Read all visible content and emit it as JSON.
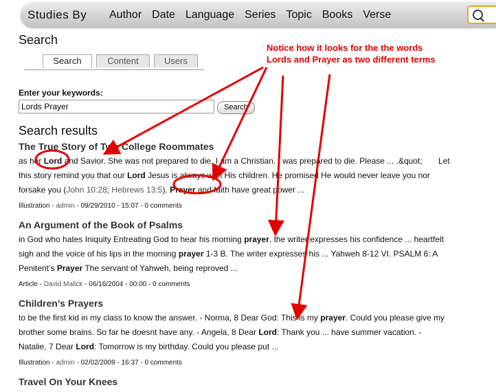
{
  "nav": {
    "brand": "Studies By",
    "items": [
      "Author",
      "Date",
      "Language",
      "Series",
      "Topic",
      "Books",
      "Verse"
    ]
  },
  "search": {
    "title": "Search",
    "tabs": [
      "Search",
      "Content",
      "Users"
    ],
    "keywords_label": "Enter your keywords:",
    "keywords_value": "Lords Prayer",
    "button_label": "Search",
    "results_title": "Search results"
  },
  "results": [
    {
      "title": "The True Story of Two College Roommates",
      "lines": [
        [
          "as her ",
          {
            "b": "Lord"
          },
          " and Savior. She was not prepared to die. I am a Christian. I was prepared to die. Please ... .&quot;       Let"
        ],
        [
          "this story remind you that our ",
          {
            "b": "Lord"
          },
          " Jesus is always with His children. He promised He would never leave you nor"
        ],
        [
          "forsake you (",
          {
            "l": "John 10:28"
          },
          "; ",
          {
            "l": "Hebrews 13:5"
          },
          "). ",
          {
            "b": "Prayer"
          },
          " and faith have great power ..."
        ]
      ],
      "meta_type": "Illustration",
      "meta_author": "admin",
      "meta_date": "09/29/2010 - 15:07",
      "meta_comments": "0 comments"
    },
    {
      "title": "An Argument of the Book of Psalms",
      "lines": [
        [
          "in God who hates Iniquity Entreating God to hear his morning ",
          {
            "b": "prayer"
          },
          ", the writer expresses his confidence ... heartfelt"
        ],
        [
          "sigh and the voice of his lips in the morning ",
          {
            "b": "prayer"
          },
          " 1-3 B. The writer expresses his ... Yahweh 8-12 VI. PSALM 6: A"
        ],
        [
          "Penitent’s ",
          {
            "b": "Prayer"
          },
          " The servant of Yahweh, being reproved ..."
        ]
      ],
      "meta_type": "Article",
      "meta_author": "David Malick",
      "meta_date": "06/16/2004 - 00:00",
      "meta_comments": "0 comments"
    },
    {
      "title": "Children’s Prayers",
      "lines": [
        [
          "to be the first kid in my class to know the answer. - Norma, 8 Dear God: This is my ",
          {
            "b": "prayer"
          },
          ". Could you please give my"
        ],
        [
          "brother some brains. So far he doesnt have any. - Angela, 8 Dear ",
          {
            "b": "Lord"
          },
          ": Thank you ... have summer vacation. -"
        ],
        [
          "Natalie, 7 Dear ",
          {
            "b": "Lord"
          },
          ": Tomorrow is my birthday. Could you please put ..."
        ]
      ],
      "meta_type": "Illustration",
      "meta_author": "admin",
      "meta_date": "02/02/2009 - 16:37",
      "meta_comments": "0 comments"
    },
    {
      "title": "Travel On Your Knees",
      "lines": [],
      "meta_type": "",
      "meta_author": "",
      "meta_date": "",
      "meta_comments": ""
    }
  ],
  "annotation": {
    "line1": "Notice how it looks for the the words",
    "line2": "Lords and Prayer as two different terms",
    "color": "#e20000"
  }
}
